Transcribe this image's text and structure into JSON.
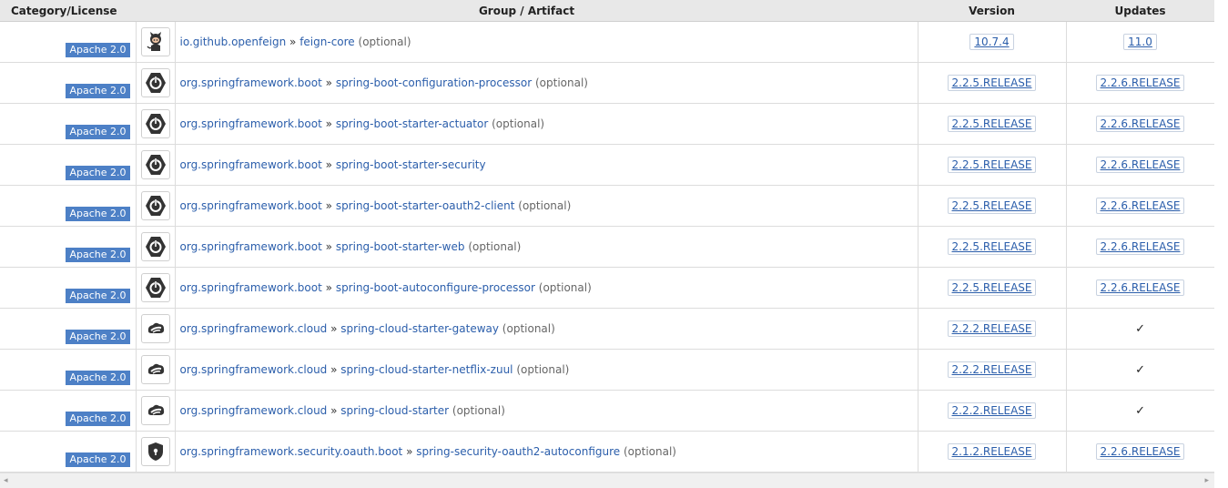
{
  "header": {
    "category": "Category/License",
    "artifact": "Group / Artifact",
    "version": "Version",
    "updates": "Updates"
  },
  "rows": [
    {
      "license": "Apache 2.0",
      "icon": "github-octocat-icon",
      "group": "io.github.openfeign",
      "sep": "»",
      "artifact": "feign-core",
      "optional": "(optional)",
      "version": "10.7.4",
      "update": "11.0"
    },
    {
      "license": "Apache 2.0",
      "icon": "spring-boot-icon",
      "group": "org.springframework.boot",
      "sep": "»",
      "artifact": "spring-boot-configuration-processor",
      "optional": "(optional)",
      "version": "2.2.5.RELEASE",
      "update": "2.2.6.RELEASE"
    },
    {
      "license": "Apache 2.0",
      "icon": "spring-boot-icon",
      "group": "org.springframework.boot",
      "sep": "»",
      "artifact": "spring-boot-starter-actuator",
      "optional": "(optional)",
      "version": "2.2.5.RELEASE",
      "update": "2.2.6.RELEASE"
    },
    {
      "license": "Apache 2.0",
      "icon": "spring-boot-icon",
      "group": "org.springframework.boot",
      "sep": "»",
      "artifact": "spring-boot-starter-security",
      "optional": "",
      "version": "2.2.5.RELEASE",
      "update": "2.2.6.RELEASE"
    },
    {
      "license": "Apache 2.0",
      "icon": "spring-boot-icon",
      "group": "org.springframework.boot",
      "sep": "»",
      "artifact": "spring-boot-starter-oauth2-client",
      "optional": "(optional)",
      "version": "2.2.5.RELEASE",
      "update": "2.2.6.RELEASE"
    },
    {
      "license": "Apache 2.0",
      "icon": "spring-boot-icon",
      "group": "org.springframework.boot",
      "sep": "»",
      "artifact": "spring-boot-starter-web",
      "optional": "(optional)",
      "version": "2.2.5.RELEASE",
      "update": "2.2.6.RELEASE"
    },
    {
      "license": "Apache 2.0",
      "icon": "spring-boot-icon",
      "group": "org.springframework.boot",
      "sep": "»",
      "artifact": "spring-boot-autoconfigure-processor",
      "optional": "(optional)",
      "version": "2.2.5.RELEASE",
      "update": "2.2.6.RELEASE"
    },
    {
      "license": "Apache 2.0",
      "icon": "spring-cloud-icon",
      "group": "org.springframework.cloud",
      "sep": "»",
      "artifact": "spring-cloud-starter-gateway",
      "optional": "(optional)",
      "version": "2.2.2.RELEASE",
      "update": "✓"
    },
    {
      "license": "Apache 2.0",
      "icon": "spring-cloud-icon",
      "group": "org.springframework.cloud",
      "sep": "»",
      "artifact": "spring-cloud-starter-netflix-zuul",
      "optional": "(optional)",
      "version": "2.2.2.RELEASE",
      "update": "✓"
    },
    {
      "license": "Apache 2.0",
      "icon": "spring-cloud-icon",
      "group": "org.springframework.cloud",
      "sep": "»",
      "artifact": "spring-cloud-starter",
      "optional": "(optional)",
      "version": "2.2.2.RELEASE",
      "update": "✓"
    },
    {
      "license": "Apache 2.0",
      "icon": "spring-security-icon",
      "group": "org.springframework.security.oauth.boot",
      "sep": "»",
      "artifact": "spring-security-oauth2-autoconfigure",
      "optional": "(optional)",
      "version": "2.1.2.RELEASE",
      "update": "2.2.6.RELEASE"
    }
  ],
  "scrollbar": {
    "left_arrow": "◂",
    "right_arrow": "▸"
  }
}
